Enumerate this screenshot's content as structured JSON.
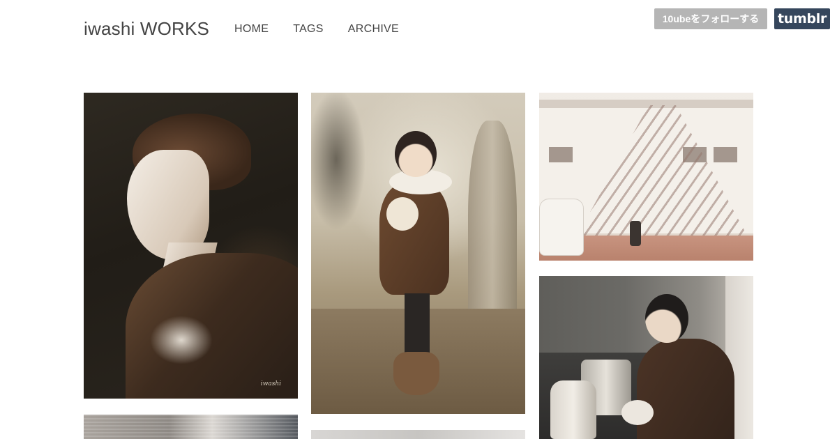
{
  "header": {
    "site_title": "iwashi WORKS",
    "nav": [
      {
        "label": "HOME"
      },
      {
        "label": "TAGS"
      },
      {
        "label": "ARCHIVE"
      }
    ]
  },
  "tumblr_bar": {
    "follow_label": "10ubeをフォローする",
    "logo_label": "tumblr",
    "follow_color": "#b5b5b5",
    "logo_color": "#35465c"
  },
  "posts": [
    {
      "subject": "profile portrait of a person in a brown coat on dark background",
      "signature": "iwashi"
    },
    {
      "subject": "child in brown coat holding a white rabbit under a tree"
    },
    {
      "subject": "white building with exterior staircase and a small car"
    },
    {
      "subject": "boy in kitchen pouring from a kettle"
    },
    {
      "subject": "partially visible artwork"
    },
    {
      "subject": "partially visible artwork"
    }
  ]
}
